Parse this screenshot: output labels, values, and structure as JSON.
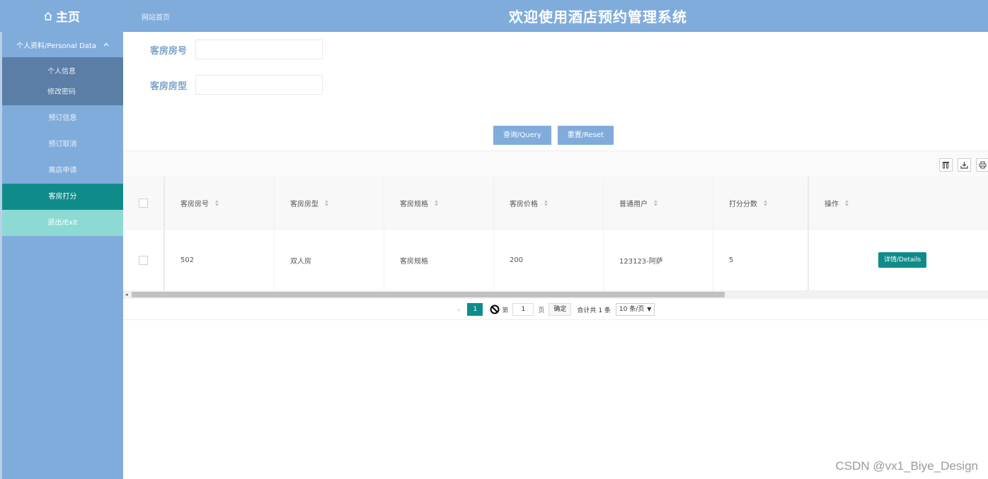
{
  "header": {
    "home_label": "主页",
    "breadcrumb": "网站首页",
    "title": "欢迎使用酒店预约管理系统"
  },
  "sidebar": {
    "group_label": "个人资料/Personal Data",
    "group_items": [
      "个人信息",
      "修改密码"
    ],
    "items": [
      {
        "label": "预订信息"
      },
      {
        "label": "预订取消"
      },
      {
        "label": "离店申请"
      },
      {
        "label": "客房打分"
      },
      {
        "label": "退出/Exit"
      }
    ]
  },
  "search": {
    "room_no_label": "客房房号",
    "room_no_value": "",
    "room_type_label": "客房房型",
    "room_type_value": "",
    "query_button": "查询/Query",
    "reset_button": "重置/Reset"
  },
  "table": {
    "columns": [
      "客房房号",
      "客房房型",
      "客房规格",
      "客房价格",
      "普通用户",
      "打分分数",
      "操作"
    ],
    "rows": [
      {
        "room_no": "502",
        "room_type": "双人房",
        "spec": "客房规格",
        "price": "200",
        "user": "123123-阿萨",
        "score": "5",
        "action": "详情/Details"
      }
    ]
  },
  "pagination": {
    "current_page": "1",
    "goto_prefix": "第",
    "goto_value": "1",
    "goto_suffix": "页",
    "confirm": "确定",
    "total": "合计共 1 条",
    "page_size": "10 条/页"
  },
  "watermark": "CSDN @vx1_Biye_Design",
  "colors": {
    "primary": "#80acdc",
    "accent": "#0f8c8a",
    "exit": "#8ddad4"
  }
}
